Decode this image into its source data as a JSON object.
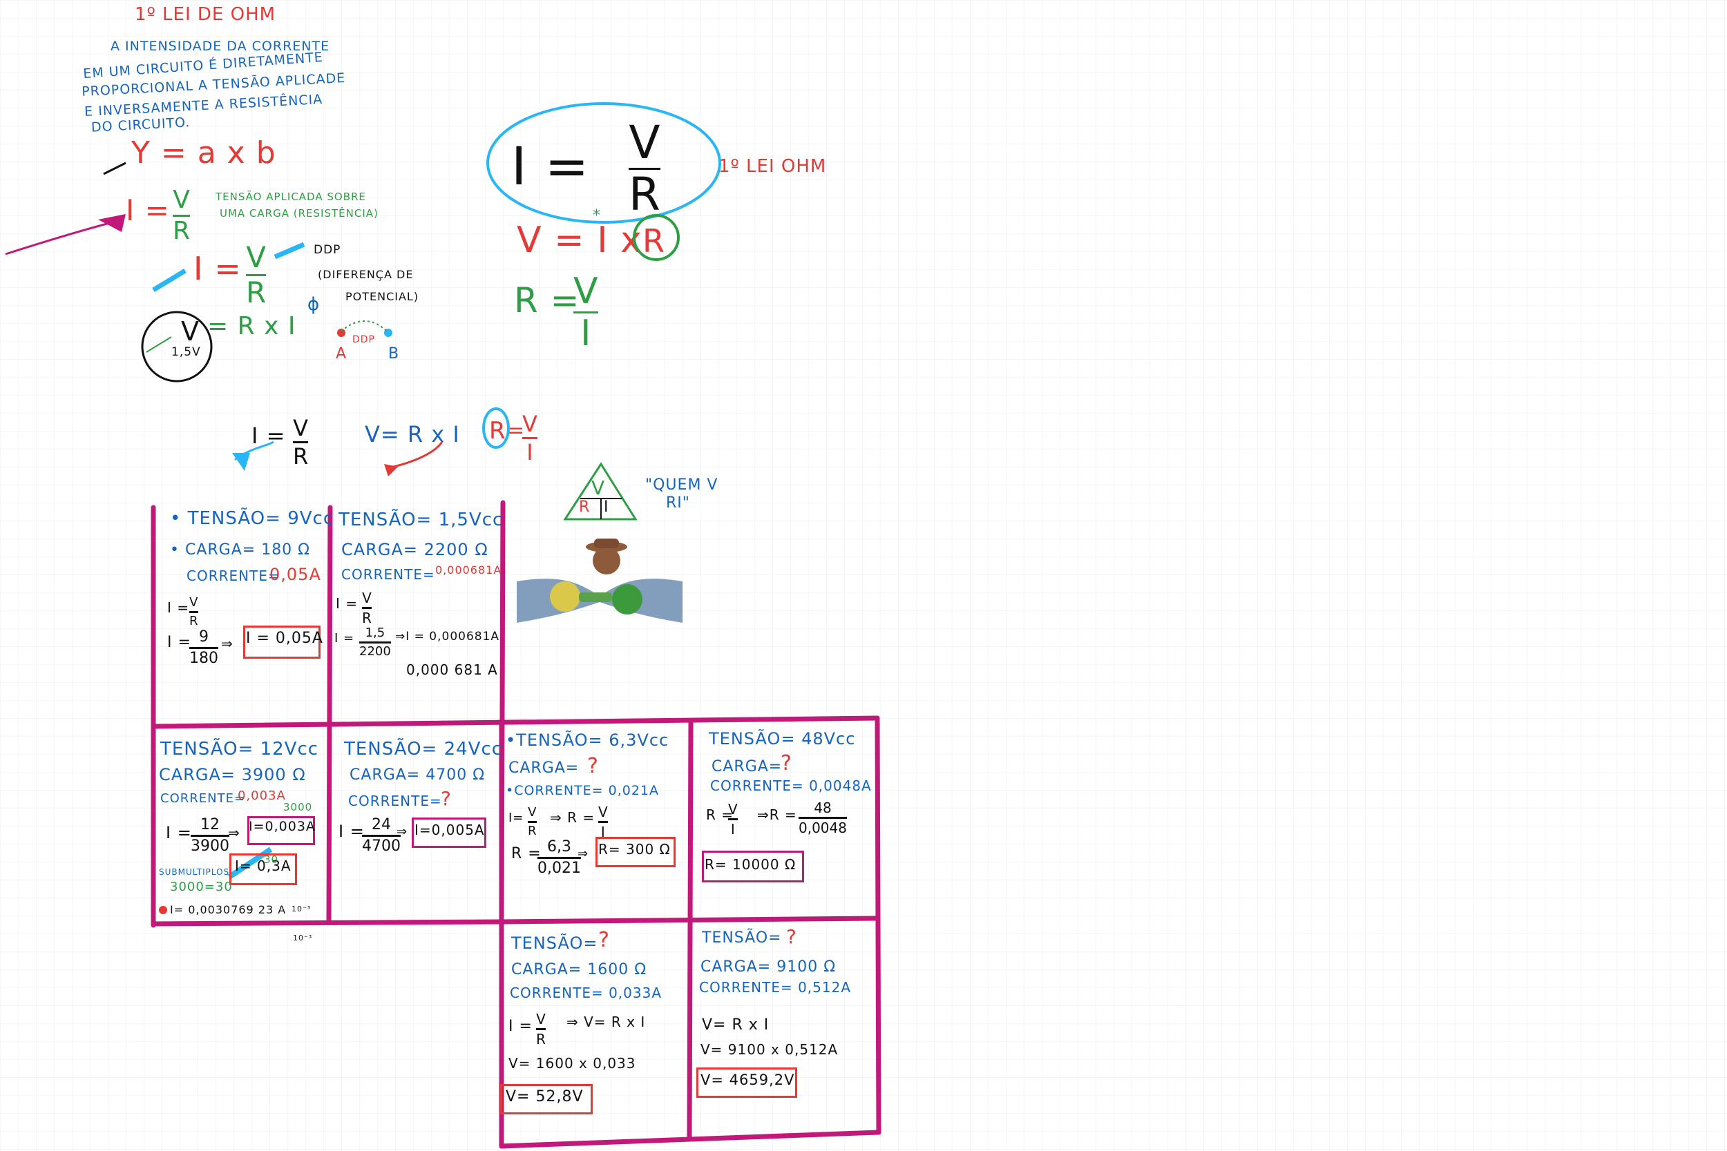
{
  "notes": {
    "title": "1º LEI DE OHM",
    "definition": [
      "A INTENSIDADE DA CORRENTE",
      "EM UM CIRCUITO É DIRETAMENTE",
      "PROPORCIONAL A TENSÃO APLICADE",
      "E INVERSAMENTE A RESISTÊNCIA",
      "DO CIRCUITO."
    ],
    "y_formula": "Y = a x b",
    "applied_note": [
      "TENSÃO APLICADA SOBRE",
      "UMA CARGA (RESISTÊNCIA)"
    ],
    "ddp_note": [
      "DDP",
      "(DIFERENÇA DE",
      "POTENCIAL)"
    ],
    "battery_value": "1,5V",
    "ddp_small": "DDP",
    "point_a": "A",
    "point_b": "B",
    "phi": "ϕ",
    "main_formula_label": "1º LEI OHM",
    "triangle_caption": [
      "\"QUEM V",
      "RI\""
    ]
  },
  "formulas": {
    "I": "I",
    "V": "V",
    "R": "R",
    "eq": "=",
    "times": "x",
    "i_eq": "I =",
    "v_eq": "V =",
    "r_eq": "R =",
    "v_rxi": "V= R x I",
    "rx_i": "= R x I",
    "mark_star": "*"
  },
  "grid": {
    "c1": {
      "voltage": "• TENSÃO= 9Vcc",
      "load": "• CARGA= 180 Ω",
      "current": "CORRENTE=",
      "current_val": "0,05A",
      "l1": "I =",
      "l2": "I =",
      "n": "9",
      "d": "180",
      "result": "I = 0,05A"
    },
    "c2": {
      "voltage": "TENSÃO= 1,5Vcc",
      "load": "CARGA= 2200 Ω",
      "current": "CORRENTE=",
      "current_val": "0,000681A",
      "l1": "I =",
      "l2": "I =",
      "n": "1,5",
      "d": "2200",
      "arrow_result": "⇒I = 0,000681A",
      "alt": "0,000 681 A"
    },
    "c3": {
      "voltage": "TENSÃO= 12Vcc",
      "load": "CARGA= 3900 Ω",
      "current": "CORRENTE=",
      "current_val": "0,003A",
      "l1": "I =",
      "n": "12",
      "d": "3900",
      "result": "I=0,003A",
      "wrong": "I= 0,3A",
      "sub_label": "SUBMULTIPLOS",
      "sub_eq": "3000=30",
      "n3000": "3000",
      "n30": "30",
      "exact": "I= 0,0030769 23 A",
      "exp1": "10⁻³",
      "exp2": "10⁻³"
    },
    "c4": {
      "voltage": "TENSÃO= 24Vcc",
      "load": "CARGA= 4700 Ω",
      "current": "CORRENTE=",
      "current_val": "?",
      "l1": "I =",
      "n": "24",
      "d": "4700",
      "result": "I=0,005A"
    },
    "c5": {
      "voltage": "•TENSÃO= 6,3Vcc",
      "load": "CARGA=",
      "load_val": "?",
      "current": "•CORRENTE= 0,021A",
      "l1": "I=",
      "arrow": "⇒ R =",
      "l2": "R =",
      "n": "6,3",
      "d": "0,021",
      "result": "R= 300 Ω"
    },
    "c6": {
      "voltage": "TENSÃO= 48Vcc",
      "load": "CARGA=",
      "load_val": "?",
      "current": "CORRENTE= 0,0048A",
      "l1": "R =",
      "arrow": "⇒R =",
      "n": "48",
      "d": "0,0048",
      "result": "R= 10000 Ω"
    },
    "c7": {
      "voltage": "TENSÃO=",
      "voltage_val": "?",
      "load": "CARGA= 1600 Ω",
      "current": "CORRENTE= 0,033A",
      "l1": "I =",
      "arrow": "⇒ V= R x I",
      "calc": "V= 1600 x 0,033",
      "result": "V= 52,8V"
    },
    "c8": {
      "voltage": "TENSÃO=",
      "voltage_val": "?",
      "load": "CARGA= 9100 Ω",
      "current": "CORRENTE= 0,512A",
      "calc1": "V= R x I",
      "calc2": "V= 9100 x 0,512A",
      "result": "V= 4659,2V"
    }
  },
  "colors": {
    "grid": "#c2187a",
    "blue": "#1565c0",
    "red": "#e53935",
    "green": "#2e9e44",
    "ellipse": "#29b6f6"
  }
}
